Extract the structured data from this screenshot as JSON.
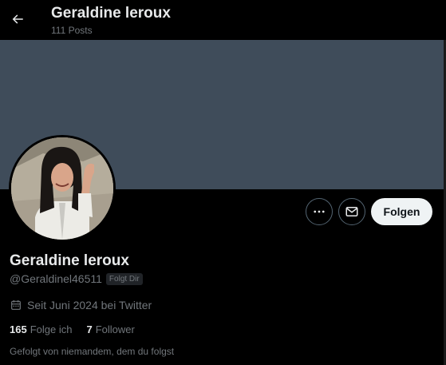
{
  "header": {
    "title": "Geraldine leroux",
    "posts_count": "111 Posts"
  },
  "colors": {
    "banner": "#3f4c5a",
    "background": "#000000",
    "follow_button_bg": "#eff3f4"
  },
  "profile": {
    "display_name": "Geraldine leroux",
    "handle": "@Geraldinel46511",
    "follows_you_badge": "Folgt Dir",
    "joined": "Seit Juni 2024 bei Twitter",
    "following_count": "165",
    "following_label": "Folge ich",
    "followers_count": "7",
    "followers_label": "Follower",
    "followed_by_text": "Gefolgt von niemandem, dem du folgst"
  },
  "actions": {
    "follow_label": "Folgen",
    "more_icon": "more-icon",
    "message_icon": "mail-icon"
  }
}
